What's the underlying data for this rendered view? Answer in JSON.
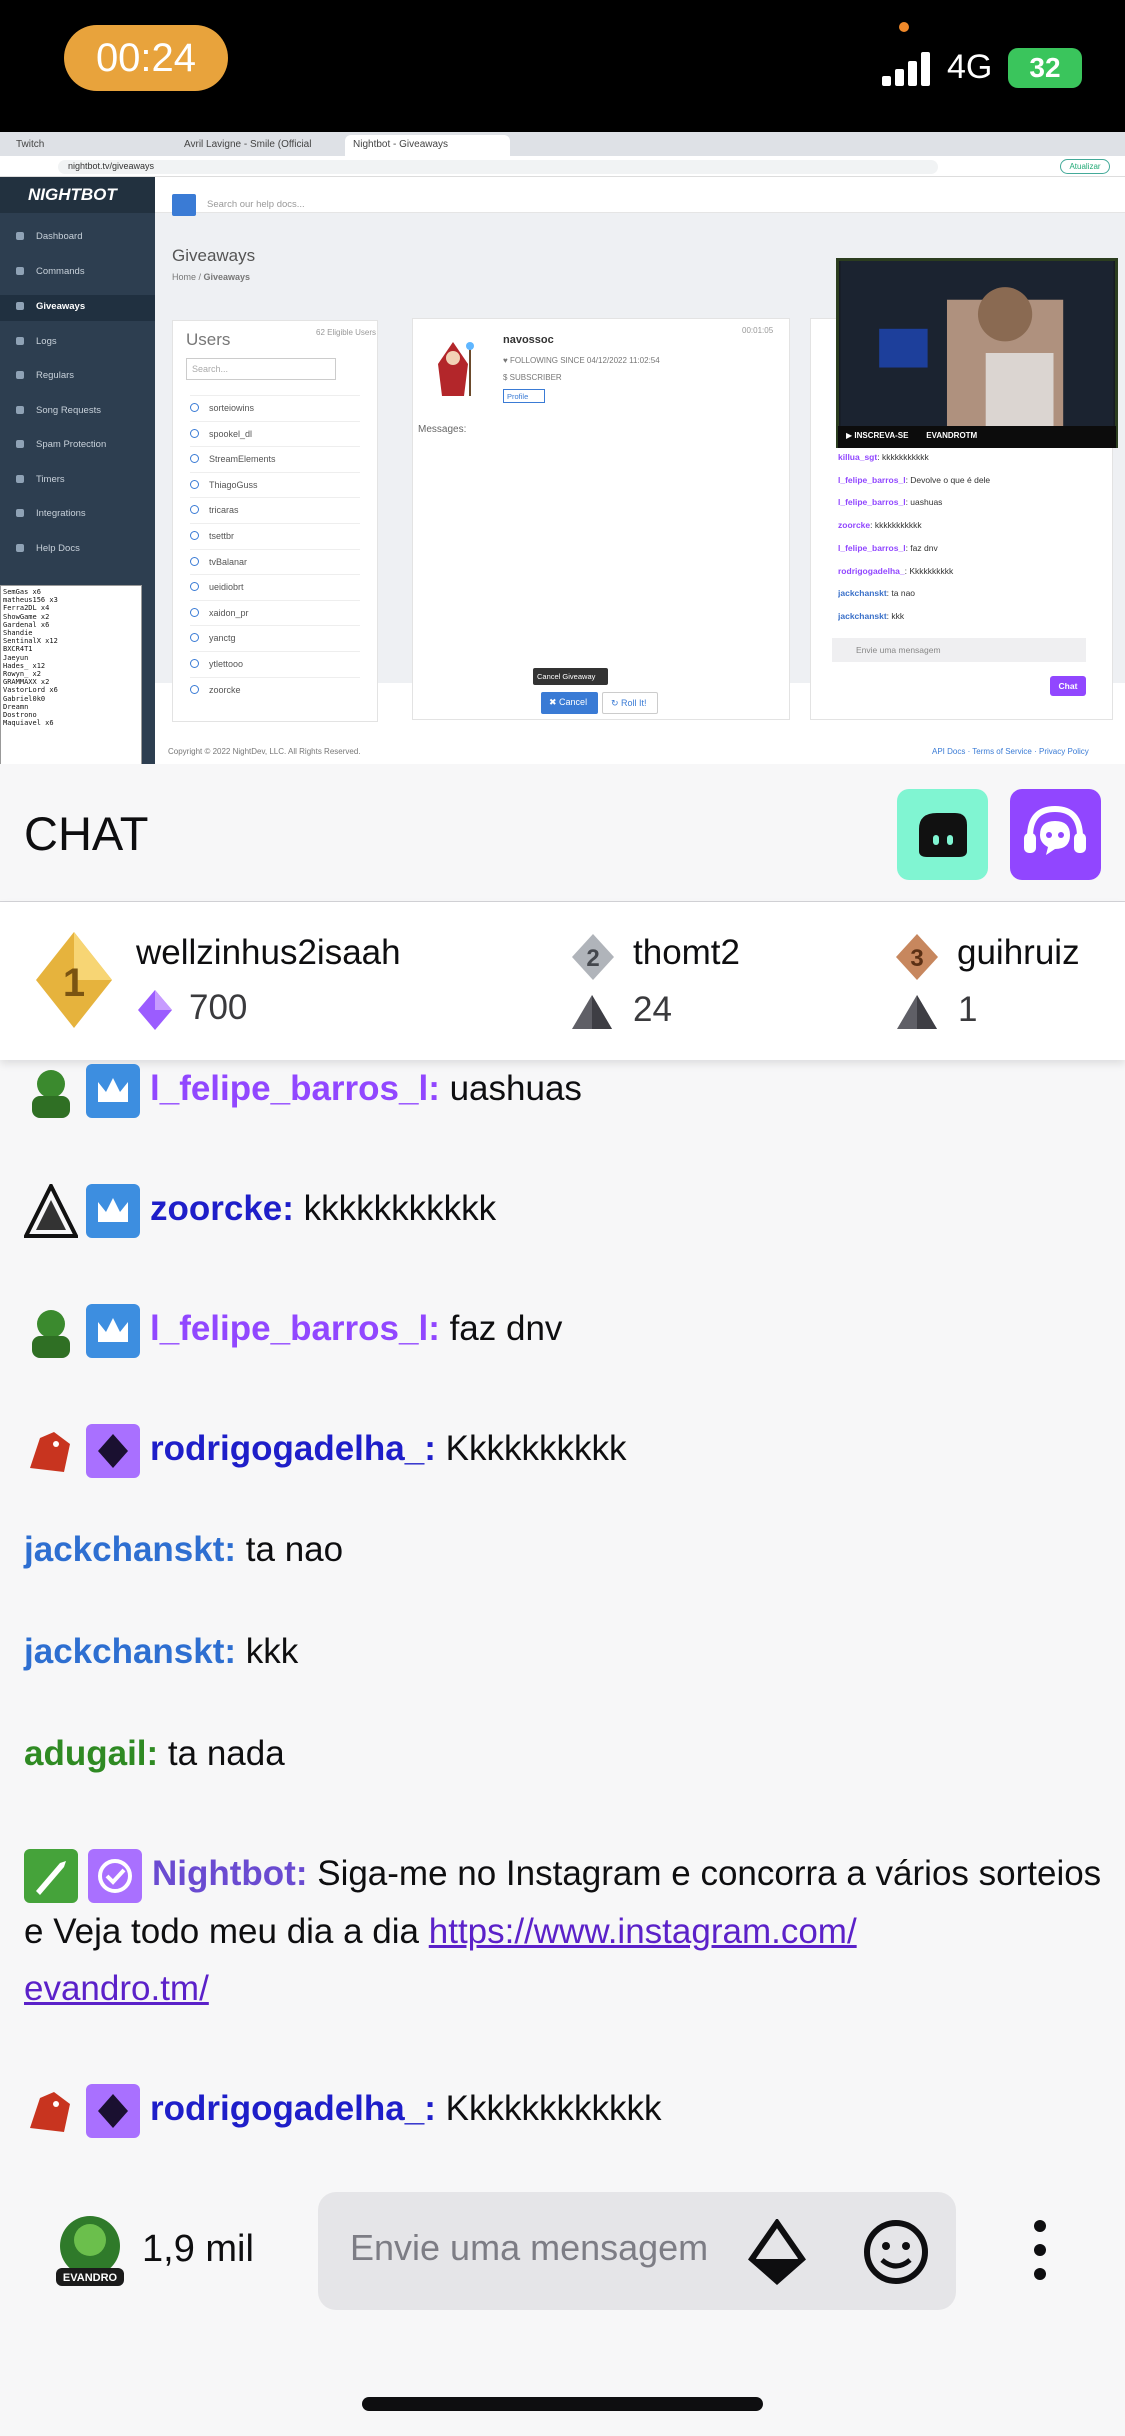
{
  "status_bar": {
    "time": "00:24",
    "network": "4G",
    "battery": "32"
  },
  "browser": {
    "tabs": [
      "Twitch",
      "Avril Lavigne - Smile (Official",
      "Nightbot - Giveaways"
    ],
    "url": "nightbot.tv/giveaways",
    "update_label": "Atualizar"
  },
  "nightbot": {
    "logo": "NIGHTBOT",
    "search_placeholder": "Search our help docs...",
    "nav": [
      "Dashboard",
      "Commands",
      "Giveaways",
      "Logs",
      "Regulars",
      "Song Requests",
      "Spam Protection",
      "Timers",
      "Integrations",
      "Help Docs"
    ],
    "page_title": "Giveaways",
    "breadcrumb_home": "Home",
    "breadcrumb_current": "Giveaways",
    "users_title": "Users",
    "eligible": "62 Eligible Users",
    "users_search": "Search...",
    "users": [
      "sorteiowins",
      "spookel_dl",
      "StreamElements",
      "ThiagoGuss",
      "tricaras",
      "tsettbr",
      "tvBalanar",
      "ueidiobrt",
      "xaidon_pr",
      "yanctg",
      "ytlettooo",
      "zoorcke"
    ],
    "winner": {
      "name": "navossoc",
      "timer": "00:01:05",
      "following": "FOLLOWING SINCE 04/12/2022 11:02:54",
      "subscriber": "SUBSCRIBER",
      "profile": "Profile"
    },
    "messages_label": "Messages:",
    "tooltip": "Cancel Giveaway",
    "cancel_label": "Cancel",
    "roll_label": "Roll It!",
    "copyright": "Copyright © 2022 NightDev, LLC. All Rights Reserved.",
    "footer_links": "API Docs · Terms of Service · Privacy Policy"
  },
  "console_lines": [
    "SemGas x6",
    "matheus156 x3",
    "Ferra2DL x4",
    "ShowGame x2",
    "Gardenal x6",
    "Shandie",
    "SentinalX x12",
    "BXCR4T1",
    "Jaeyun",
    "Hades_ x12",
    "Rowyn_ x2",
    "GRAMMAXX x2",
    "VastorLord x6",
    "Gabriel0k0",
    "Dreamn",
    "Dostrono",
    "Maquiavel x6"
  ],
  "mini_chat": {
    "overlay_subscribe": "INSCREVA-SE",
    "overlay_name": "EVANDROTM",
    "messages": [
      {
        "user": "killua_sgt",
        "text": "kkkkkkkkkkk"
      },
      {
        "user": "l_felipe_barros_l",
        "text": "Devolve o que é dele"
      },
      {
        "user": "l_felipe_barros_l",
        "text": "uashuas"
      },
      {
        "user": "zoorcke",
        "text": "kkkkkkkkkkk"
      },
      {
        "user": "l_felipe_barros_l",
        "text": "faz dnv"
      },
      {
        "user": "rodrigogadelha_",
        "text": "Kkkkkkkkkk"
      },
      {
        "user": "jackchanskt",
        "text": "ta nao"
      },
      {
        "user": "jackchanskt",
        "text": "kkk"
      }
    ],
    "input_placeholder": "Envie uma mensagem",
    "chat_button": "Chat"
  },
  "chat": {
    "title": "CHAT",
    "leaderboard": [
      {
        "rank": "1",
        "name": "wellzinhus2isaah",
        "score": "700"
      },
      {
        "rank": "2",
        "name": "thomt2",
        "score": "24"
      },
      {
        "rank": "3",
        "name": "guihruiz",
        "score": "1"
      }
    ],
    "messages": [
      {
        "user": "l_felipe_barros_l:",
        "text": "uashuas"
      },
      {
        "user": "zoorcke:",
        "text": "kkkkkkkkkkk"
      },
      {
        "user": "l_felipe_barros_l:",
        "text": "faz dnv"
      },
      {
        "user": "rodrigogadelha_:",
        "text": "Kkkkkkkkkk"
      },
      {
        "user": "jackchanskt:",
        "text": "ta nao"
      },
      {
        "user": "jackchanskt:",
        "text": "kkk"
      },
      {
        "user": "adugail:",
        "text": "ta nada"
      },
      {
        "user": "Nightbot:",
        "text": "Siga-me no Instagram e concorra a vários sorteios e Veja todo meu dia a dia",
        "link1": "https://www.instagram.com/",
        "link2": "evandro.tm/"
      },
      {
        "user": "rodrigogadelha_:",
        "text": "Kkkkkkkkkkkk"
      }
    ],
    "viewer_count": "1,9 mil",
    "input_placeholder": "Envie uma mensagem",
    "viewer_badge": "EVANDRO"
  },
  "colors": {
    "twitch_purple": "#9147ff",
    "streamlabs_mint": "#80f5d2",
    "status_pill": "#e8a33c",
    "battery_green": "#3ac55c"
  }
}
